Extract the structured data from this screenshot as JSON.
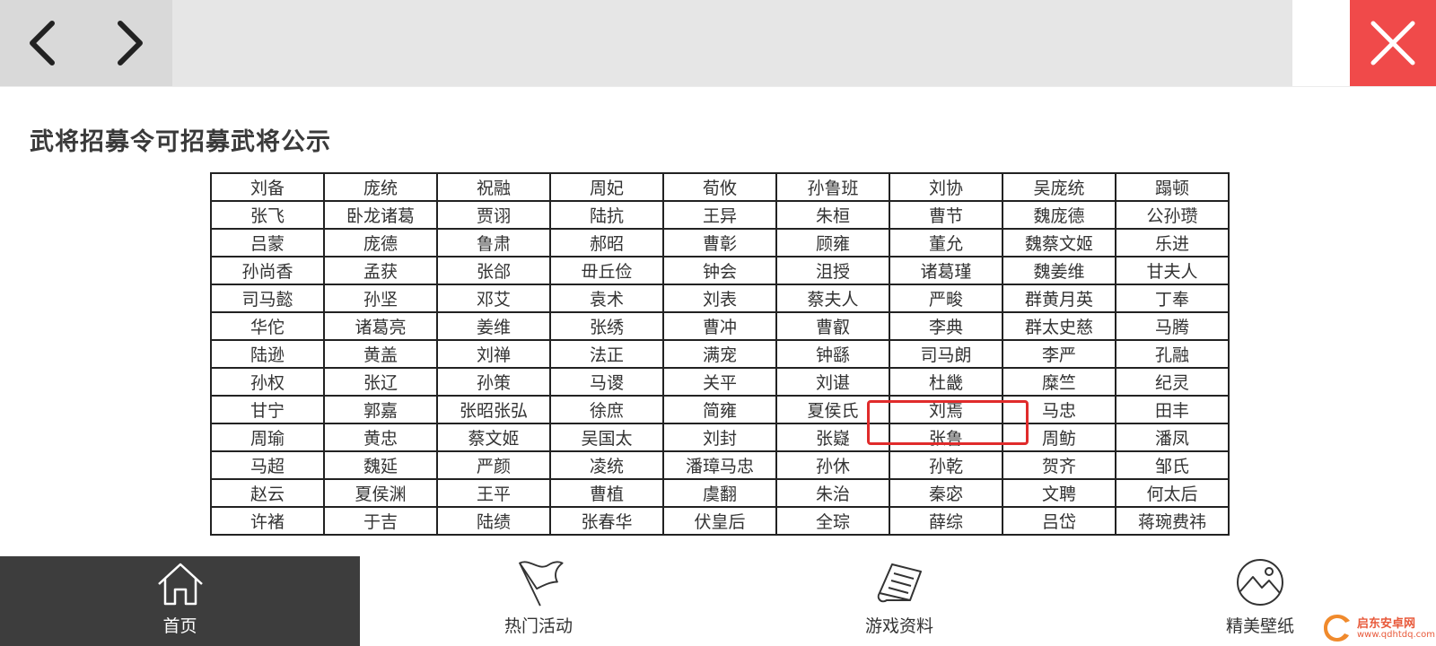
{
  "page": {
    "title": "武将招募令可招募武将公示"
  },
  "toolbar": {
    "back_icon": "chevron-left-icon",
    "forward_icon": "chevron-right-icon",
    "close_icon": "close-icon",
    "close_color": "#f04a4a"
  },
  "generals": [
    [
      "刘备",
      "庞统",
      "祝融",
      "周妃",
      "荀攸",
      "孙鲁班",
      "刘协",
      "吴庞统",
      "蹋顿"
    ],
    [
      "张飞",
      "卧龙诸葛",
      "贾诩",
      "陆抗",
      "王异",
      "朱桓",
      "曹节",
      "魏庞德",
      "公孙瓒"
    ],
    [
      "吕蒙",
      "庞德",
      "鲁肃",
      "郝昭",
      "曹彰",
      "顾雍",
      "董允",
      "魏蔡文姬",
      "乐进"
    ],
    [
      "孙尚香",
      "孟获",
      "张郃",
      "毌丘俭",
      "钟会",
      "沮授",
      "诸葛瑾",
      "魏姜维",
      "甘夫人"
    ],
    [
      "司马懿",
      "孙坚",
      "邓艾",
      "袁术",
      "刘表",
      "蔡夫人",
      "严畯",
      "群黄月英",
      "丁奉"
    ],
    [
      "华佗",
      "诸葛亮",
      "姜维",
      "张绣",
      "曹冲",
      "曹叡",
      "李典",
      "群太史慈",
      "马腾"
    ],
    [
      "陆逊",
      "黄盖",
      "刘禅",
      "法正",
      "满宠",
      "钟繇",
      "司马朗",
      "李严",
      "孔融"
    ],
    [
      "孙权",
      "张辽",
      "孙策",
      "马谡",
      "关平",
      "刘谌",
      "杜畿",
      "糜竺",
      "纪灵"
    ],
    [
      "甘宁",
      "郭嘉",
      "张昭张弘",
      "徐庶",
      "简雍",
      "夏侯氏",
      "刘焉",
      "马忠",
      "田丰"
    ],
    [
      "周瑜",
      "黄忠",
      "蔡文姬",
      "吴国太",
      "刘封",
      "张嶷",
      "张鲁",
      "周鲂",
      "潘凤"
    ],
    [
      "马超",
      "魏延",
      "严颜",
      "凌统",
      "潘璋马忠",
      "孙休",
      "孙乾",
      "贺齐",
      "邹氏"
    ],
    [
      "赵云",
      "夏侯渊",
      "王平",
      "曹植",
      "虞翻",
      "朱治",
      "秦宓",
      "文聘",
      "何太后"
    ],
    [
      "许褚",
      "于吉",
      "陆绩",
      "张春华",
      "伏皇后",
      "全琮",
      "薛综",
      "吕岱",
      "蒋琬费祎"
    ]
  ],
  "highlight": {
    "general": "刘焉",
    "color": "#e02b2b"
  },
  "bottom_nav": {
    "home": {
      "label": "首页",
      "icon": "home-icon",
      "active": true
    },
    "events": {
      "label": "热门活动",
      "icon": "flag-icon"
    },
    "info": {
      "label": "游戏资料",
      "icon": "scroll-icon"
    },
    "wallpaper": {
      "label": "精美壁纸",
      "icon": "picture-icon"
    }
  },
  "watermark": {
    "name": "启东安卓网",
    "url": "www.qdhtdq.com"
  }
}
